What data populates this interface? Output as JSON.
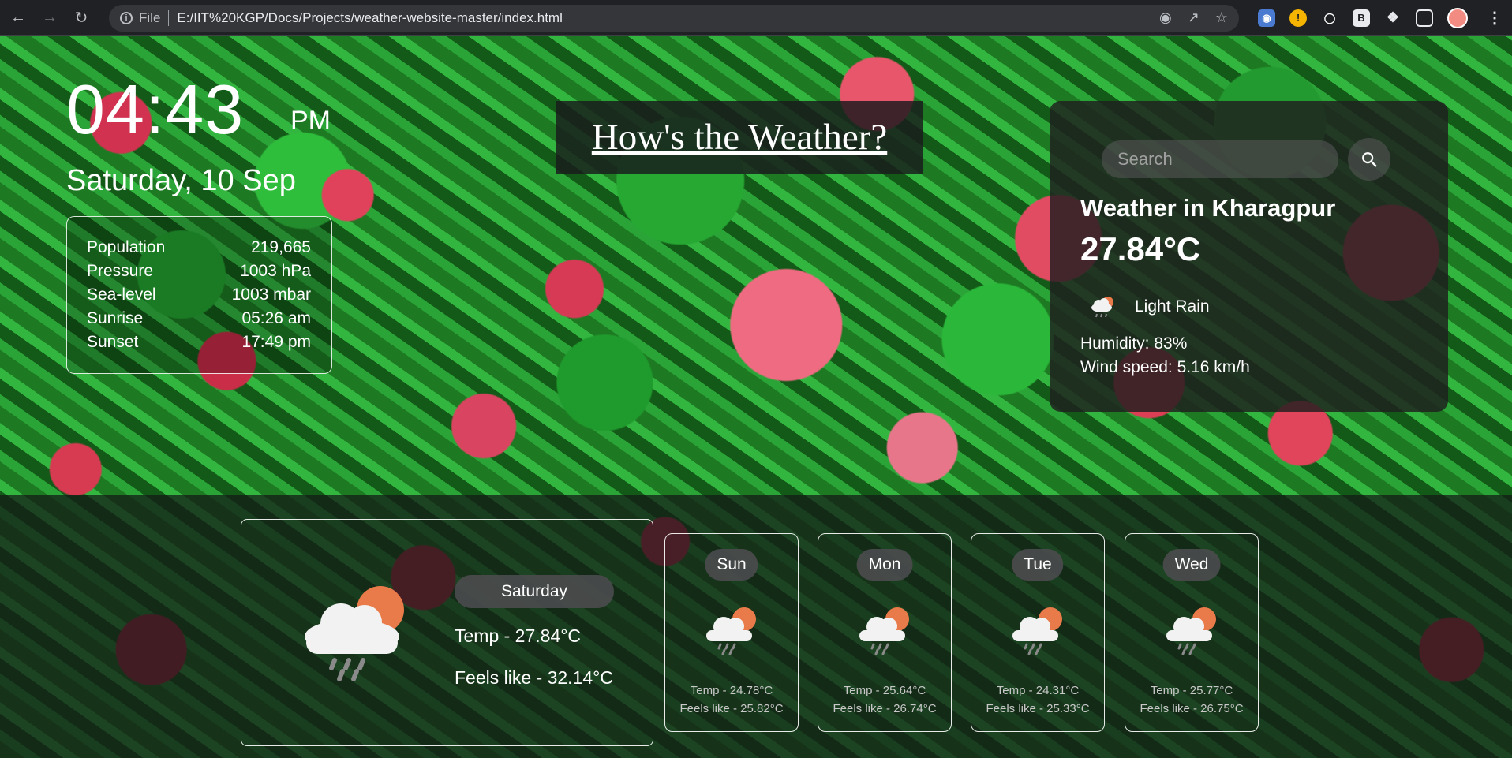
{
  "browser": {
    "file_label": "File",
    "url": "E:/IIT%20KGP/Docs/Projects/weather-website-master/index.html"
  },
  "clock": {
    "time": "04:43",
    "ampm": "PM",
    "date": "Saturday, 10 Sep"
  },
  "stats": [
    {
      "label": "Population",
      "value": "219,665"
    },
    {
      "label": "Pressure",
      "value": "1003 hPa"
    },
    {
      "label": "Sea-level",
      "value": "1003 mbar"
    },
    {
      "label": "Sunrise",
      "value": "05:26 am"
    },
    {
      "label": "Sunset",
      "value": "17:49 pm"
    }
  ],
  "title": "How's the Weather?",
  "weather": {
    "search_placeholder": "Search",
    "city": "Weather in Kharagpur",
    "temp": "27.84°C",
    "description": "Light Rain",
    "humidity": "Humidity: 83%",
    "wind": "Wind speed: 5.16 km/h",
    "icon": "light-rain-cloud-sun-icon"
  },
  "today": {
    "day": "Saturday",
    "temp": "Temp - 27.84°C",
    "feels": "Feels like - 32.14°C",
    "icon": "rain-cloud-sun-icon"
  },
  "forecast": [
    {
      "day": "Sun",
      "temp": "Temp - 24.78°C",
      "feels": "Feels like - 25.82°C"
    },
    {
      "day": "Mon",
      "temp": "Temp - 25.64°C",
      "feels": "Feels like - 26.74°C"
    },
    {
      "day": "Tue",
      "temp": "Temp - 24.31°C",
      "feels": "Feels like - 25.33°C"
    },
    {
      "day": "Wed",
      "temp": "Temp - 25.77°C",
      "feels": "Feels like - 26.75°C"
    }
  ],
  "colors": {
    "sun": "#e97a4a",
    "cloud": "#f2f2f2",
    "rain": "#8a8a8a"
  }
}
